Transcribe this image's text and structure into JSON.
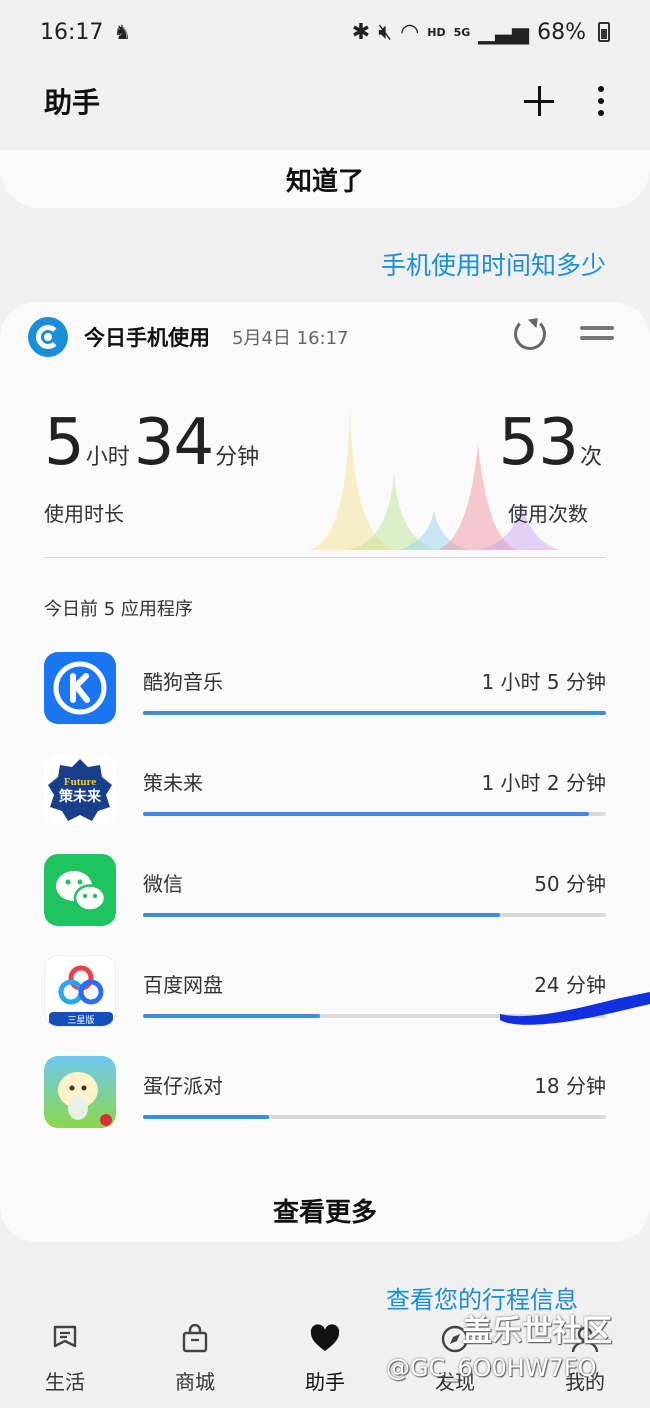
{
  "status_bar": {
    "time": "16:17",
    "network_hd": "HD",
    "network_5g": "5G",
    "battery": "68%"
  },
  "header": {
    "title": "助手"
  },
  "got_it": {
    "label": "知道了"
  },
  "usage_link": "手机使用时间知多少",
  "usage_card": {
    "title": "今日手机使用",
    "date": "5月4日 16:17",
    "hours": "5",
    "hours_unit": "小时",
    "minutes": "34",
    "minutes_unit": "分钟",
    "duration_label": "使用时长",
    "unlocks": "53",
    "unlocks_unit": "次",
    "unlocks_label": "使用次数",
    "top_apps_label": "今日前 5 应用程序",
    "apps": [
      {
        "name": "酷狗音乐",
        "time": "1 小时 5 分钟",
        "fraction": 1.0,
        "icon": "kugou-icon"
      },
      {
        "name": "策未来",
        "time": "1 小时 2 分钟",
        "fraction": 0.963,
        "icon": "future-icon"
      },
      {
        "name": "微信",
        "time": "50 分钟",
        "fraction": 0.772,
        "icon": "wechat-icon"
      },
      {
        "name": "百度网盘",
        "time": "24 分钟",
        "fraction": 0.382,
        "icon": "baidu-netdisk-icon"
      },
      {
        "name": "蛋仔派对",
        "time": "18 分钟",
        "fraction": 0.272,
        "icon": "eggy-party-icon"
      }
    ],
    "app_icon_texts": {
      "future_top": "Future",
      "future_bottom": "策未来",
      "baidu_badge": "三星版"
    },
    "see_more": "查看更多"
  },
  "trip_link": "查看您的行程信息",
  "bottom_nav": [
    {
      "label": "生活",
      "icon": "life-icon"
    },
    {
      "label": "商城",
      "icon": "shop-icon"
    },
    {
      "label": "助手",
      "icon": "heart-icon"
    },
    {
      "label": "发现",
      "icon": "compass-icon"
    },
    {
      "label": "我的",
      "icon": "profile-icon"
    }
  ],
  "watermark": {
    "site": "盖乐世社区",
    "user": "@GC_6O0HW7FQ"
  },
  "colors": {
    "accent": "#1a8fd8",
    "bar": "#3b8de0",
    "redaction": "#1230e0"
  }
}
